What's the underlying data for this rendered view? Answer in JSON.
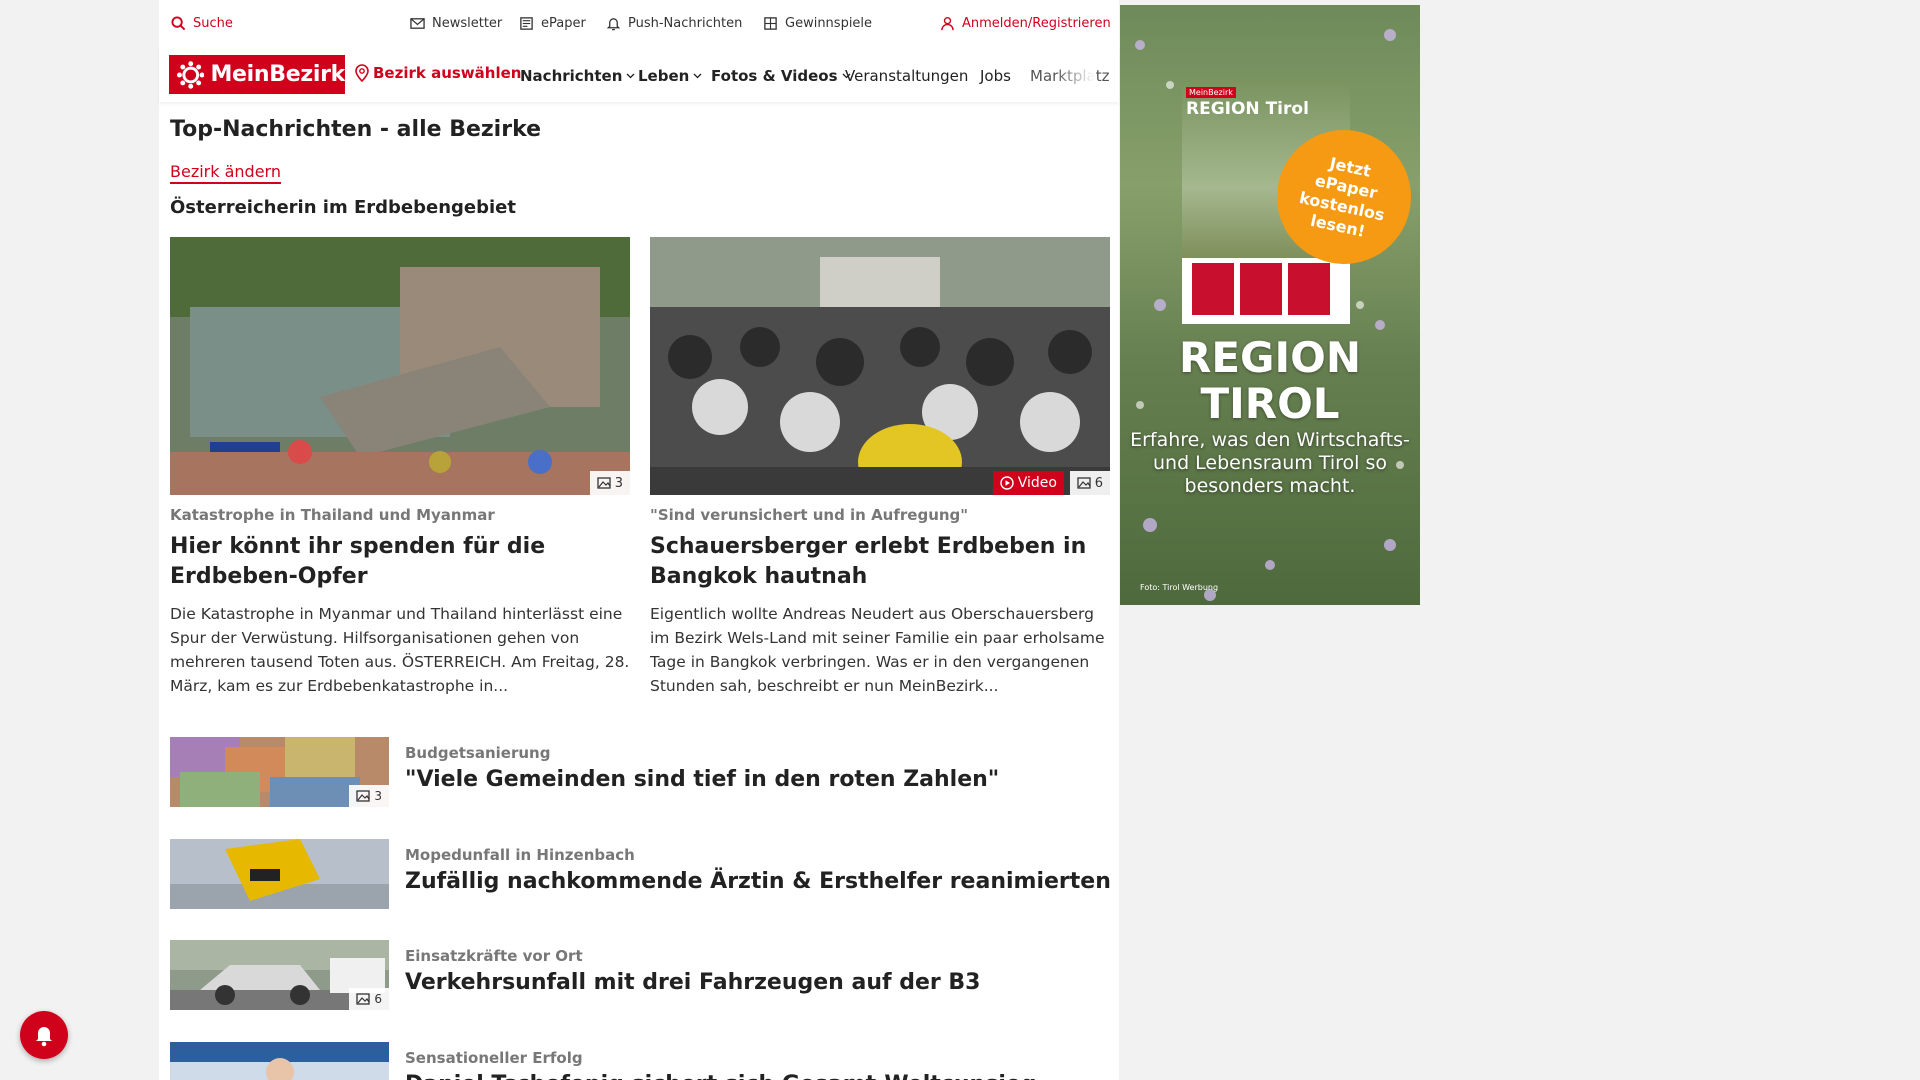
{
  "topbar": {
    "search_label": "Suche",
    "newsletter_label": "Newsletter",
    "epaper_label": "ePaper",
    "push_label": "Push-Nachrichten",
    "contests_label": "Gewinnspiele",
    "login_label": "Anmelden/Registrieren"
  },
  "nav": {
    "logo_text": "MeinBezirk",
    "district_select": "Bezirk auswählen",
    "items": [
      {
        "label": "Nachrichten"
      },
      {
        "label": "Leben"
      },
      {
        "label": "Fotos & Videos"
      },
      {
        "label": "Veranstaltungen"
      },
      {
        "label": "Jobs"
      },
      {
        "label": "Marktplatz"
      }
    ]
  },
  "page": {
    "title": "Top-Nachrichten - alle Bezirke",
    "change_district": "Bezirk ändern",
    "section": "Österreicherin im Erdbebengebiet"
  },
  "featured": [
    {
      "kicker": "Katastrophe in Thailand und Myanmar",
      "headline": "Hier könnt ihr spenden für die Erdbeben-Opfer",
      "teaser": "Die Katastrophe in Myanmar und Thailand hinterlässt eine Spur der Verwüstung. Hilfsorganisationen gehen von mehreren tausend Toten aus.  ÖSTERREICH. Am Freitag, 28. März, kam es zur Erdbebenkatastrophe in...",
      "photo_count": "3"
    },
    {
      "kicker": "\"Sind verunsichert und in Aufregung\"",
      "headline": "Schauersberger erlebt Erdbeben in Bangkok hautnah",
      "teaser": "Eigentlich wollte Andreas Neudert aus Oberschauersberg im Bezirk Wels-Land mit seiner Familie ein paar erholsame Tage in Bangkok verbringen. Was er in den vergangenen Stunden sah, beschreibt er nun MeinBezirk...",
      "video_label": "Video",
      "photo_count": "6"
    }
  ],
  "list": [
    {
      "kicker": "Budgetsanierung",
      "headline": "\"Viele Gemeinden sind tief in den roten Zahlen\"",
      "photo_count": "3"
    },
    {
      "kicker": "Mopedunfall in Hinzenbach",
      "headline": "Zufällig nachkommende Ärztin & Ersthelfer reanimierten"
    },
    {
      "kicker": "Einsatzkräfte vor Ort",
      "headline": "Verkehrsunfall mit drei Fahrzeugen auf der B3",
      "photo_count": "6"
    },
    {
      "kicker": "Sensationeller Erfolg",
      "headline": "Daniel Tschofenig sichert sich Gesamt-Weltcupsieg"
    }
  ],
  "ad": {
    "epaper_brand": "MeinBezirk",
    "epaper_title": "REGION Tirol",
    "circle_text": "Jetzt\nePaper\nkostenlos\nlesen!",
    "big_title": "REGION\nTIROL",
    "subtitle": "Erfahre, was den Wirtschafts- und Lebensraum Tirol so besonders macht.",
    "credit": "Foto: Tirol Werbung"
  },
  "colors": {
    "brand": "#d0021b",
    "ad_accent": "#f59a12"
  }
}
